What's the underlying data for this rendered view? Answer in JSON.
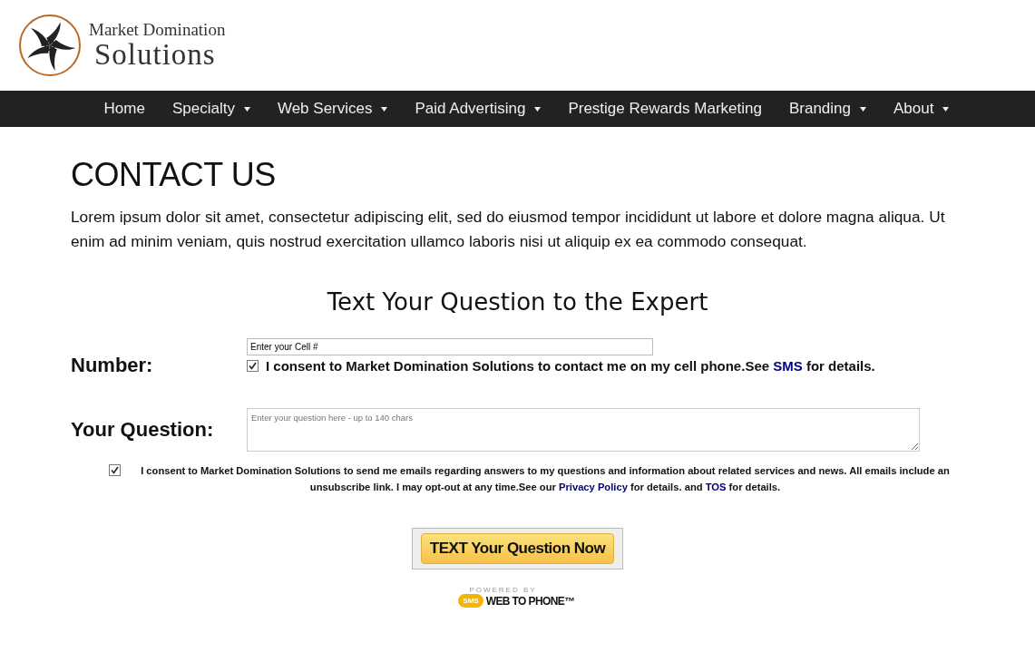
{
  "logo": {
    "line1": "Market Domination",
    "line2": "Solutions"
  },
  "nav": [
    {
      "label": "Home",
      "has_dropdown": false
    },
    {
      "label": "Specialty",
      "has_dropdown": true
    },
    {
      "label": "Web Services",
      "has_dropdown": true
    },
    {
      "label": "Paid Advertising",
      "has_dropdown": true
    },
    {
      "label": "Prestige Rewards Marketing",
      "has_dropdown": false
    },
    {
      "label": "Branding",
      "has_dropdown": true
    },
    {
      "label": "About",
      "has_dropdown": true
    }
  ],
  "page_title": "CONTACT US",
  "intro": "Lorem ipsum dolor sit amet, consectetur adipiscing elit, sed do eiusmod tempor incididunt ut labore et dolore magna aliqua. Ut enim ad minim veniam, quis nostrud exercitation ullamco laboris nisi ut aliquip ex ea commodo consequat.",
  "form": {
    "title": "Text Your Question to the Expert",
    "number_label": "Number:",
    "number_value": "Enter your Cell #",
    "sms_consent": {
      "checked": true,
      "before": "I consent to Market Domination Solutions to contact me on my cell phone.See ",
      "link": "SMS",
      "after": " for details."
    },
    "question_label": "Your Question:",
    "question_placeholder": "Enter your question here - up to 140 chars",
    "email_consent": {
      "checked": true,
      "before": "I consent to Market Domination Solutions to send me emails regarding answers to my questions and information about related services and news. All emails include an unsubscribe link. I may opt-out at any time.See our ",
      "link1": "Privacy Policy",
      "middle": " for details. and ",
      "link2": "TOS",
      "after": " for details."
    },
    "submit": "TEXT Your Question Now",
    "powered": {
      "caption": "POWERED BY",
      "badge": "SMS",
      "brand": "WEB TO PHONE™"
    }
  }
}
